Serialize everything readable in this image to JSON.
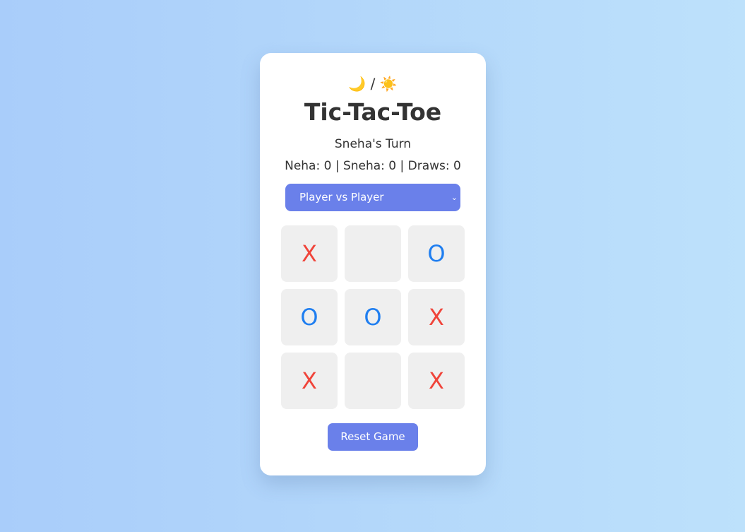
{
  "theme_toggle": {
    "moon": "🌙",
    "separator": "/",
    "sun": "☀️"
  },
  "title": "Tic-Tac-Toe",
  "status": "Sneha's Turn",
  "score": "Neha: 0 | Sneha: 0 | Draws: 0",
  "mode_select": {
    "selected": "Player vs Player",
    "chevron": "⌄"
  },
  "board": {
    "cells": [
      "X",
      "",
      "O",
      "O",
      "O",
      "X",
      "X",
      "",
      "X"
    ]
  },
  "reset_label": "Reset Game",
  "colors": {
    "x_mark": "#f0443a",
    "o_mark": "#1f7ef0",
    "accent": "#6a80ea"
  }
}
